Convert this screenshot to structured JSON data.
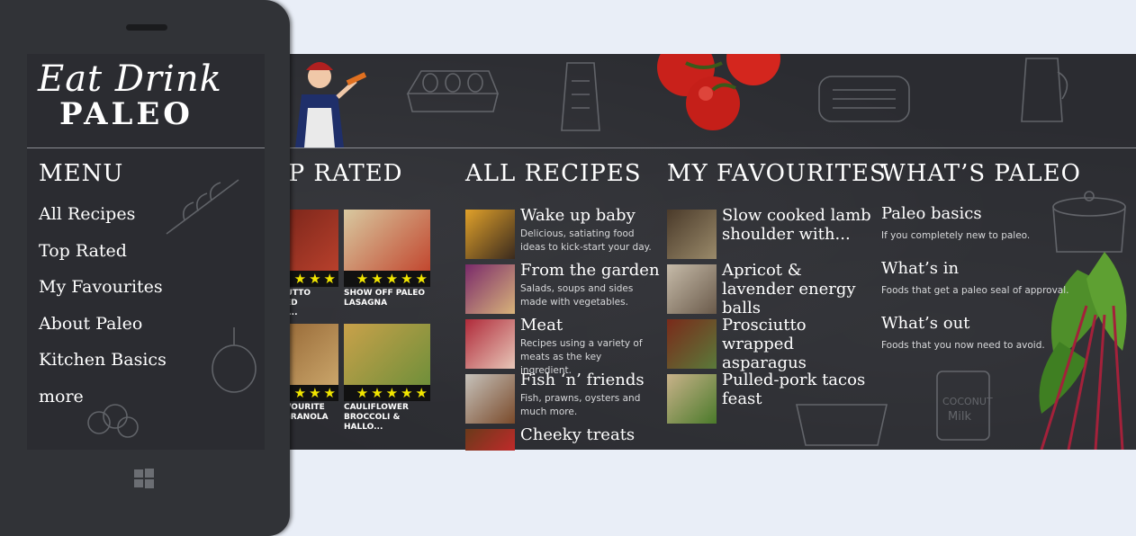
{
  "app": {
    "logo_line1": "Eat Drink",
    "logo_line2": "PALEO"
  },
  "colors": {
    "chalkboard": "#2b2c31",
    "background": "#e9eef7",
    "phone_frame": "#313337",
    "star": "#f2e600"
  },
  "menu": {
    "title": "MENU",
    "items": [
      "All Recipes",
      "Top Rated",
      "My Favourites",
      "About Paleo",
      "Kitchen Basics",
      "more"
    ]
  },
  "top_rated": {
    "title": "TOP RATED",
    "tiles": [
      {
        "caption": "PROSCIUTTO WRAPPED ASPARA...",
        "stars": "★★★",
        "colorA": "#6b1f16",
        "colorB": "#b8402c"
      },
      {
        "caption": "SHOW OFF PALEO LASAGNA",
        "stars": "★★★★★",
        "colorA": "#d8c9a0",
        "colorB": "#c2472f"
      },
      {
        "caption": "OUR FAVOURITE PALEO GRANOLA",
        "stars": "★★★",
        "colorA": "#8a5a2a",
        "colorB": "#caa56a"
      },
      {
        "caption": "CAULIFLOWER BROCCOLI & HALLO...",
        "stars": "★★★★★",
        "colorA": "#c9a14a",
        "colorB": "#6f8f3a"
      }
    ]
  },
  "all_recipes": {
    "title": "ALL RECIPES",
    "items": [
      {
        "title": "Wake up baby",
        "desc": "Delicious, satiating food ideas to kick-start your day.",
        "colorA": "#e0a12a",
        "colorB": "#3a2a1e"
      },
      {
        "title": "From the garden",
        "desc": "Salads, soups and sides made with vegetables.",
        "colorA": "#7a2a6a",
        "colorB": "#d8b37a"
      },
      {
        "title": "Meat",
        "desc": "Recipes using a variety of meats as the key ingredient.",
        "colorA": "#b02a3a",
        "colorB": "#e7c7b8"
      },
      {
        "title": "Fish ‘n’ friends",
        "desc": "Fish, prawns, oysters and much more.",
        "colorA": "#c6c2bb",
        "colorB": "#7a4a2a"
      },
      {
        "title": "Cheeky treats",
        "desc": "",
        "colorA": "#6a3a1a",
        "colorB": "#c02a2a"
      }
    ]
  },
  "favourites": {
    "title": "MY FAVOURITES",
    "items": [
      {
        "title": "Slow cooked lamb shoulder with...",
        "colorA": "#4a3a2a",
        "colorB": "#9a8a6a"
      },
      {
        "title": "Apricot & lavender energy balls",
        "colorA": "#c6bba9",
        "colorB": "#6a5a4a"
      },
      {
        "title": "Prosciutto wrapped asparagus",
        "colorA": "#7a2a1a",
        "colorB": "#5a7a3a"
      },
      {
        "title": "Pulled-pork tacos feast",
        "colorA": "#c9b28a",
        "colorB": "#4a7a2a"
      }
    ]
  },
  "whats_paleo": {
    "title": "WHAT’S PALEO",
    "items": [
      {
        "title": "Paleo basics",
        "desc": "If you completely new to paleo."
      },
      {
        "title": "What’s in",
        "desc": "Foods that get a paleo seal of approval."
      },
      {
        "title": "What’s out",
        "desc": "Foods that you now need to avoid."
      }
    ]
  }
}
